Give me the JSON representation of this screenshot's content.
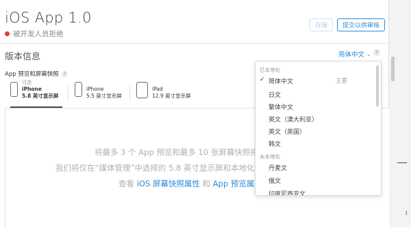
{
  "header": {
    "app_title": "iOS App 1.0",
    "status_text": "被开发人员拒绝",
    "status_color": "#e23b3b",
    "save_label": "存储",
    "submit_label": "提交以供审核"
  },
  "version_info": {
    "title": "版本信息",
    "language_selected": "简体中文",
    "help_icon": "?"
  },
  "preview": {
    "label": "App 预览和屏幕快照",
    "help_icon": "?",
    "devices": [
      {
        "sub": "可选",
        "name": "iPhone",
        "size": "5.8 英寸显示屏",
        "selected": true
      },
      {
        "sub": "",
        "name": "iPhone",
        "size": "5.5 英寸显示屏",
        "selected": false
      },
      {
        "sub": "",
        "name": "iPad",
        "size": "12.9 英寸显示屏",
        "selected": false
      }
    ],
    "drop_text_1": "将最多 3 个 App 预览和最多 10 张屏幕快照拖",
    "drop_text_2": "我们将仅在“媒体管理”中选择的 5.8 英寸显示屏和本地化",
    "drop_text_3_prefix": "查看 ",
    "drop_link_1": "iOS 屏幕快照属性",
    "drop_text_3_mid": "和 ",
    "drop_link_2": "App 预览属性"
  },
  "language_menu": {
    "localized_header": "已本地化",
    "localized": [
      {
        "label": "简体中文",
        "checked": true,
        "tag": "主要"
      },
      {
        "label": "日文",
        "checked": false,
        "tag": ""
      },
      {
        "label": "繁体中文",
        "checked": false,
        "tag": ""
      },
      {
        "label": "英文（澳大利亚）",
        "checked": false,
        "tag": ""
      },
      {
        "label": "英文（英国）",
        "checked": false,
        "tag": ""
      },
      {
        "label": "韩文",
        "checked": false,
        "tag": ""
      }
    ],
    "unlocalized_header": "未本地化",
    "unlocalized": [
      "丹麦文",
      "俄文",
      "印度尼西亚文"
    ]
  },
  "colors": {
    "accent": "#2a8ad9",
    "status_error": "#e23b3b"
  }
}
